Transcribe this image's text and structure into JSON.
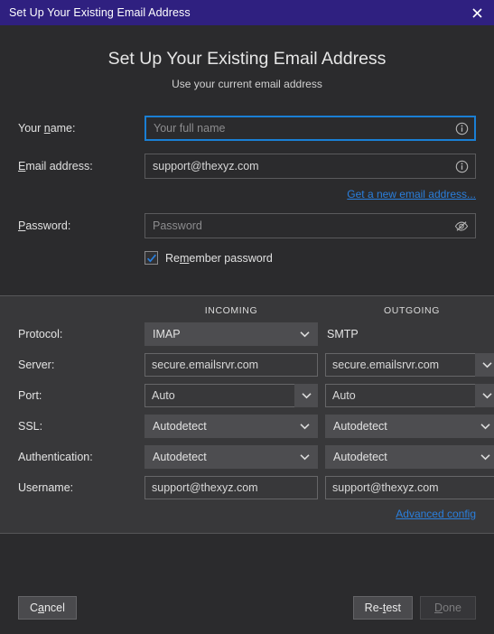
{
  "titlebar": {
    "title": "Set Up Your Existing Email Address",
    "close_icon": "close-icon",
    "bg_color": "#2f2080"
  },
  "header": {
    "title": "Set Up Your Existing Email Address",
    "subtitle": "Use your current email address"
  },
  "form": {
    "name": {
      "label": "Your name:",
      "label_mnemonic": "n",
      "value": "",
      "placeholder": "Your full name",
      "icon": "info-icon",
      "focused": true
    },
    "email": {
      "label": "Email address:",
      "label_mnemonic": "E",
      "value": "support@thexyz.com",
      "placeholder": "",
      "icon": "info-icon"
    },
    "get_new_email_link": {
      "text": "Get a new email address...",
      "mnemonic": "G",
      "color": "#2a7fdd"
    },
    "password": {
      "label": "Password:",
      "label_mnemonic": "P",
      "value": "",
      "placeholder": "Password",
      "icon": "eye-slash-icon"
    },
    "remember_password": {
      "label": "Remember password",
      "mnemonic": "m",
      "checked": true,
      "check_color": "#2a7fdd"
    }
  },
  "settings": {
    "columns": {
      "incoming": "INCOMING",
      "outgoing": "OUTGOING"
    },
    "rows": [
      {
        "label": "Protocol:",
        "incoming": {
          "type": "select",
          "value": "IMAP"
        },
        "outgoing": {
          "type": "text",
          "value": "SMTP"
        }
      },
      {
        "label": "Server:",
        "incoming": {
          "type": "input",
          "value": "secure.emailsrvr.com"
        },
        "outgoing": {
          "type": "combo",
          "value": "secure.emailsrvr.com"
        }
      },
      {
        "label": "Port:",
        "incoming": {
          "type": "combo",
          "value": "Auto"
        },
        "outgoing": {
          "type": "combo",
          "value": "Auto"
        }
      },
      {
        "label": "SSL:",
        "incoming": {
          "type": "select",
          "value": "Autodetect"
        },
        "outgoing": {
          "type": "select",
          "value": "Autodetect"
        }
      },
      {
        "label": "Authentication:",
        "incoming": {
          "type": "select",
          "value": "Autodetect"
        },
        "outgoing": {
          "type": "select",
          "value": "Autodetect"
        }
      },
      {
        "label": "Username:",
        "incoming": {
          "type": "input",
          "value": "support@thexyz.com"
        },
        "outgoing": {
          "type": "input",
          "value": "support@thexyz.com"
        }
      }
    ],
    "advanced_config_link": {
      "text": "Advanced config",
      "mnemonic": "A",
      "color": "#2a7fdd"
    }
  },
  "footer": {
    "cancel": {
      "label": "Cancel",
      "mnemonic": "a",
      "disabled": false
    },
    "retest": {
      "label": "Re-test",
      "mnemonic": "t",
      "disabled": false
    },
    "done": {
      "label": "Done",
      "mnemonic": "D",
      "disabled": true
    }
  }
}
